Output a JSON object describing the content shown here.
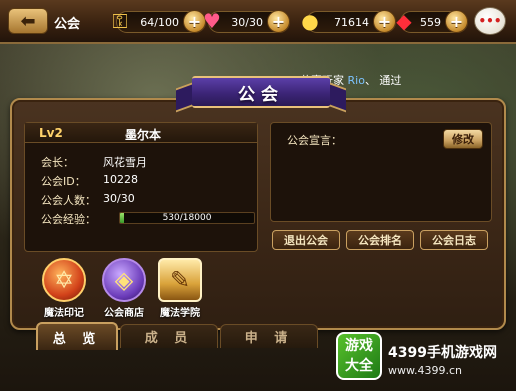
{
  "topbar": {
    "title": "公会",
    "keys": "64/100",
    "hearts": "30/30",
    "gold": "71614",
    "gems": "559"
  },
  "notice": {
    "prefix": "恭喜玩家",
    "player": "Rio",
    "suffix": "、 通过"
  },
  "ribbon": {
    "title": "公会"
  },
  "guild": {
    "level": "Lv2",
    "name": "墨尔本",
    "leader_label": "会长：",
    "leader": "风花雪月",
    "id_label": "公会ID：",
    "id": "10228",
    "members_label": "公会人数：",
    "members": "30/30",
    "exp_label": "公会经验：",
    "exp_text": "530/18000",
    "exp_fraction": 0.0294
  },
  "declaration": {
    "label": "公会宣言：",
    "edit_button": "修改"
  },
  "actions": {
    "quit": "退出公会",
    "ranking": "公会排名",
    "log": "公会日志"
  },
  "features": [
    {
      "label": "魔法印记",
      "icon": "pentagram-icon"
    },
    {
      "label": "公会商店",
      "icon": "treasure-bag-icon"
    },
    {
      "label": "魔法学院",
      "icon": "book-icon"
    }
  ],
  "tabs": [
    "总 览",
    "成 员",
    "申 请"
  ],
  "watermark": {
    "badge_top": "游戏",
    "badge_bottom": "大全",
    "title": "4399手机游戏网",
    "url": "www.4399.cn"
  },
  "colors": {
    "panel_border": "#b18a4c",
    "ribbon_purple": "#3c2577",
    "exp_fill": "#3a9a2a"
  }
}
